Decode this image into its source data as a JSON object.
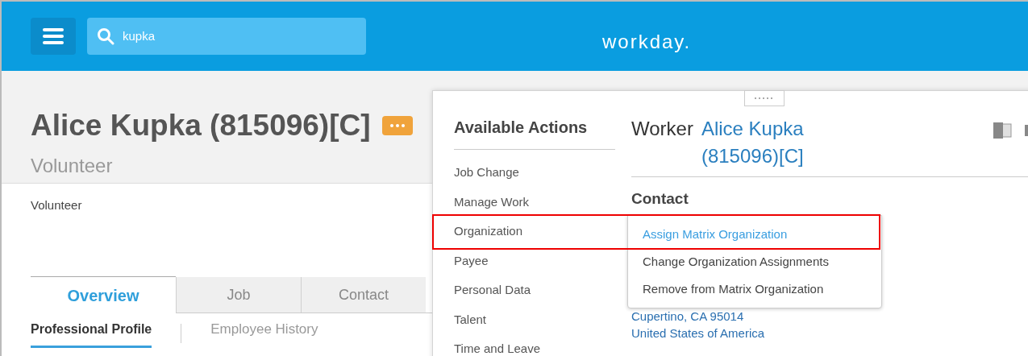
{
  "header": {
    "search": {
      "value": "kupka"
    },
    "logo": "workday."
  },
  "profile": {
    "name": "Alice Kupka (815096)[C]",
    "subtitle": "Volunteer",
    "summary": "Volunteer"
  },
  "tabs": [
    {
      "label": "Overview",
      "selected": true
    },
    {
      "label": "Job",
      "selected": false
    },
    {
      "label": "Contact",
      "selected": false
    }
  ],
  "subtabs": [
    {
      "label": "Professional Profile",
      "selected": true
    },
    {
      "label": "Employee History",
      "selected": false
    }
  ],
  "actions_popup": {
    "title": "Available Actions",
    "items": [
      {
        "label": "Job Change"
      },
      {
        "label": "Manage Work"
      },
      {
        "label": "Organization"
      },
      {
        "label": "Payee"
      },
      {
        "label": "Personal Data"
      },
      {
        "label": "Talent"
      },
      {
        "label": "Time and Leave"
      }
    ],
    "submenu": [
      {
        "label": "Assign Matrix Organization",
        "selected": true
      },
      {
        "label": "Change Organization Assignments",
        "selected": false
      },
      {
        "label": "Remove from Matrix Organization",
        "selected": false
      }
    ],
    "worker": {
      "label": "Worker",
      "name": "Alice Kupka (815096)[C]",
      "section": "Contact",
      "address": [
        "Cupertino, CA 95014",
        "United States of America"
      ]
    }
  }
}
